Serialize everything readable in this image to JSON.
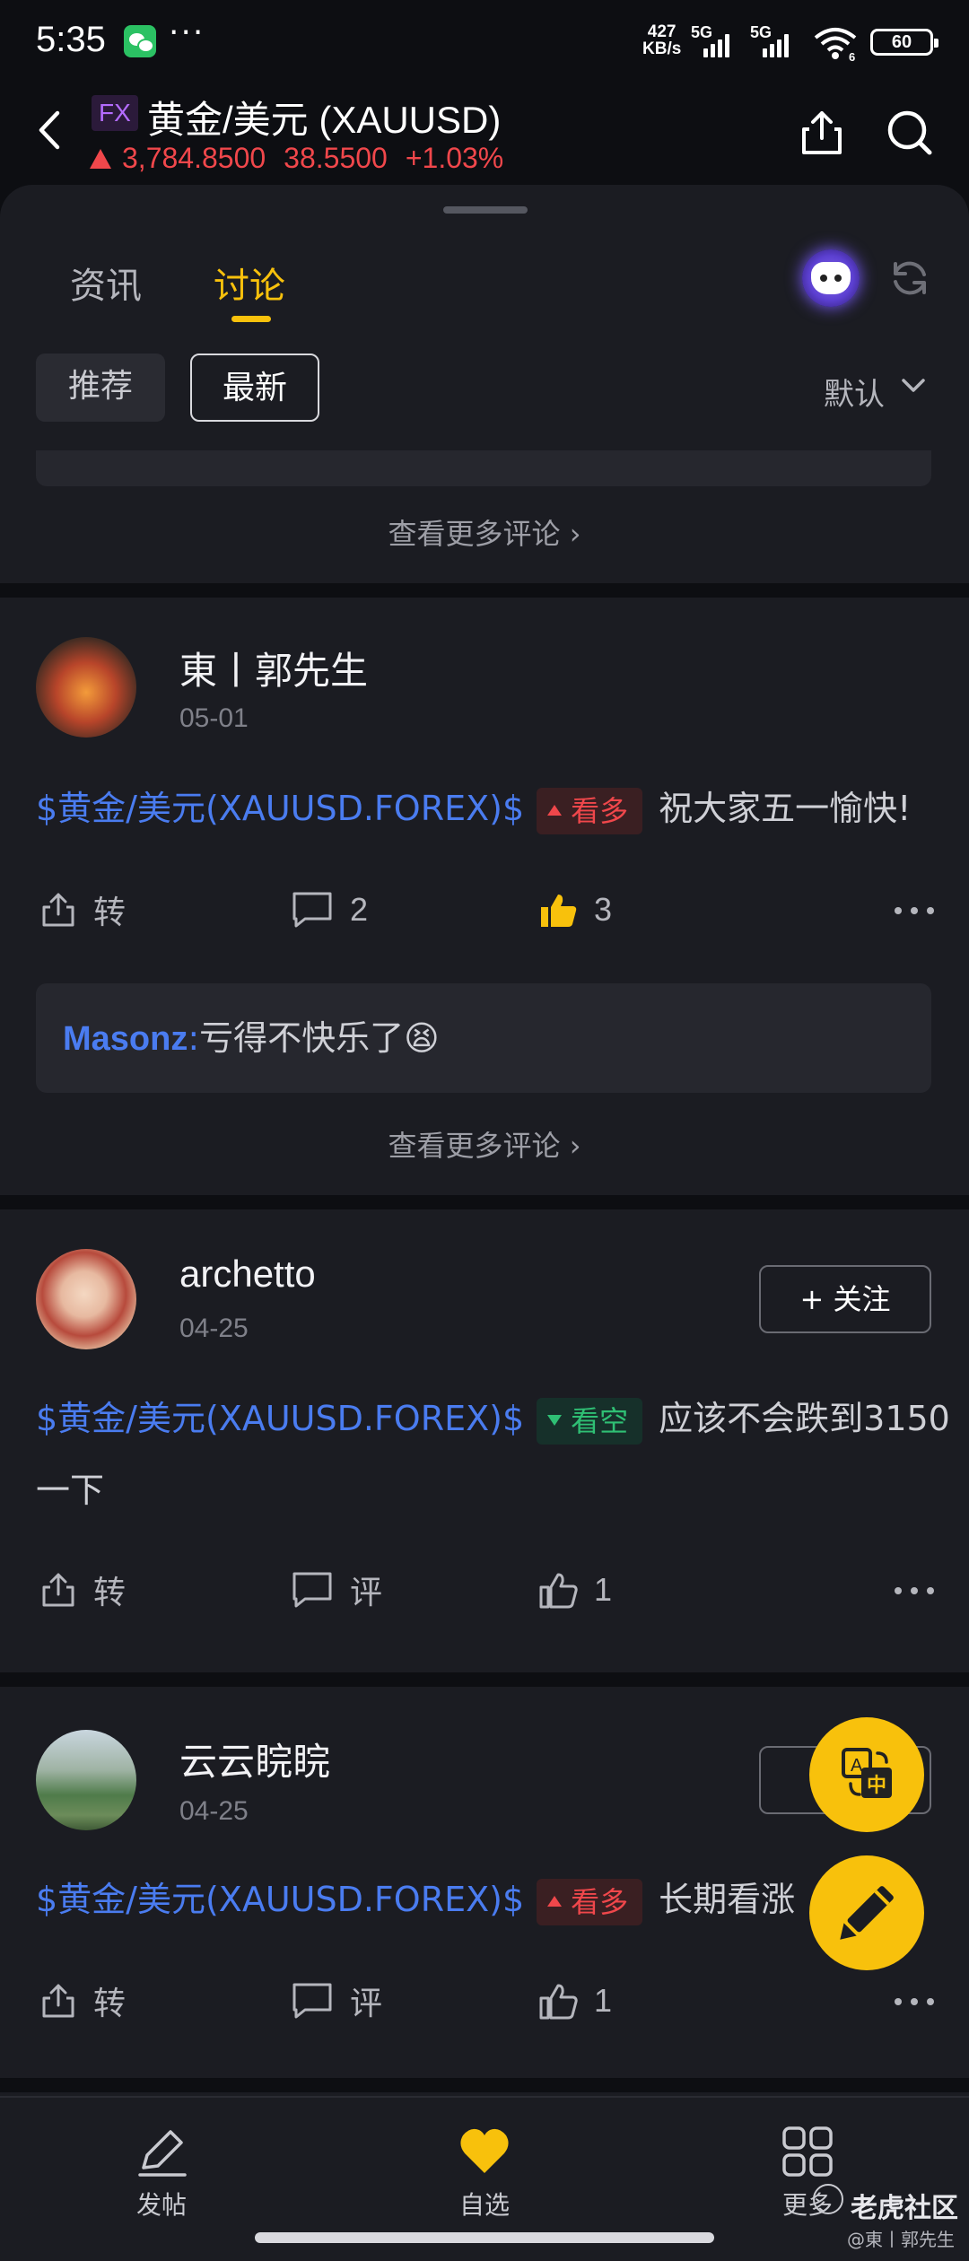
{
  "status_bar": {
    "time": "5:35",
    "net_speed_value": "427",
    "net_speed_unit": "KB/s",
    "signal1_label": "5G",
    "signal2_label": "5G",
    "wifi_label": "6",
    "battery": "60"
  },
  "header": {
    "badge": "FX",
    "title": "黄金/美元 (XAUUSD)",
    "price": "3,784.8500",
    "change": "38.5500",
    "change_pct": "+1.03%"
  },
  "tabs": [
    {
      "label": "资讯"
    },
    {
      "label": "讨论"
    }
  ],
  "filters": {
    "recommend": "推荐",
    "latest": "最新",
    "sort": "默认"
  },
  "see_more": "查看更多评论",
  "posts": [
    {
      "username": "東丨郭先生",
      "date": "05-01",
      "stock": "$黄金/美元(XAUUSD.FOREX)$",
      "sentiment": "看多",
      "text": "祝大家五一愉快!",
      "repost": "转",
      "comments": "2",
      "likes": "3",
      "reply_user": "Masonz",
      "reply_sep": ":",
      "reply_text": "亏得不快乐了😫"
    },
    {
      "username": "archetto",
      "date": "04-25",
      "follow": "+ 关注",
      "stock": "$黄金/美元(XAUUSD.FOREX)$",
      "sentiment": "看空",
      "text": "应该不会跌到3150",
      "text_cont": "一下",
      "repost": "转",
      "comments": "评",
      "likes": "1"
    },
    {
      "username": "云云睆睆",
      "date": "04-25",
      "stock": "$黄金/美元(XAUUSD.FOREX)$",
      "sentiment": "看多",
      "text": "长期看涨",
      "repost": "转",
      "comments": "评",
      "likes": "1"
    }
  ],
  "fab": {
    "translate_glyph": "中",
    "translate_glyph_a": "A"
  },
  "bottom_nav": [
    {
      "label": "发帖"
    },
    {
      "label": "自选"
    },
    {
      "label": "更多"
    }
  ],
  "watermark": {
    "brand": "老虎社区",
    "user": "@東丨郭先生"
  },
  "colors": {
    "accent": "#f8c10c",
    "up": "#f0474b",
    "down": "#2fbf74",
    "link": "#4a7cf0"
  }
}
